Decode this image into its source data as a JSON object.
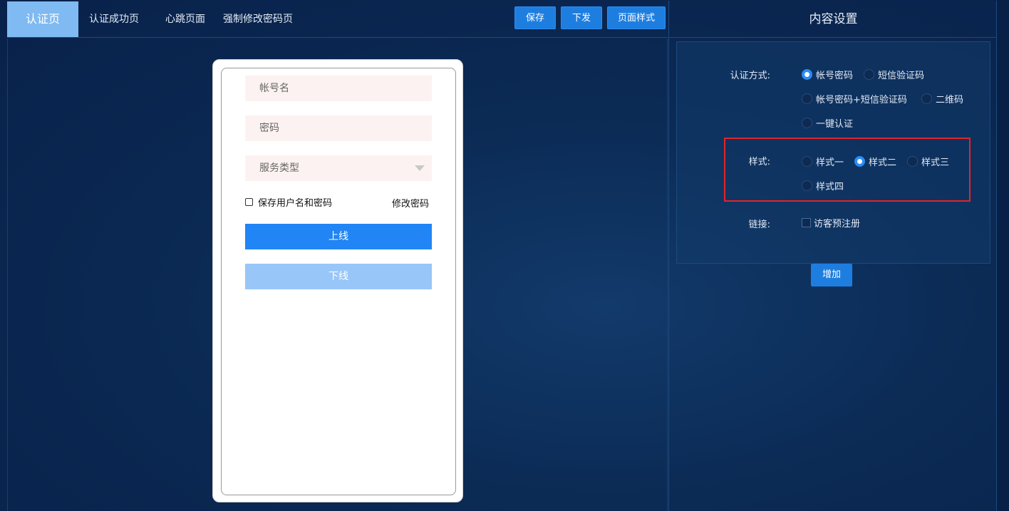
{
  "tabs": [
    {
      "label": "认证页"
    },
    {
      "label": "认证成功页"
    },
    {
      "label": "心跳页面"
    },
    {
      "label": "强制修改密码页"
    }
  ],
  "toolbar": {
    "save_label": "保存",
    "deploy_label": "下发",
    "page_style_label": "页面样式"
  },
  "preview": {
    "account_placeholder": "帐号名",
    "password_placeholder": "密码",
    "service_type_placeholder": "服务类型",
    "remember_label": "保存用户名和密码",
    "modify_password_link": "修改密码",
    "online_button": "上线",
    "offline_button": "下线"
  },
  "settings": {
    "title": "内容设置",
    "auth_method_label": "认证方式:",
    "auth_methods": [
      "帐号密码",
      "短信验证码",
      "帐号密码+短信验证码",
      "二维码",
      "一键认证"
    ],
    "auth_selected": "帐号密码",
    "style_label": "样式:",
    "styles": [
      "样式一",
      "样式二",
      "样式三",
      "样式四"
    ],
    "style_selected": "样式二",
    "link_label": "链接:",
    "link_option": "访客预注册",
    "add_button": "增加"
  },
  "colors": {
    "accent": "#1e7ee0",
    "active_tab": "#7fbaf2",
    "highlight_border": "#e0242b",
    "background": "#0b2a54"
  }
}
